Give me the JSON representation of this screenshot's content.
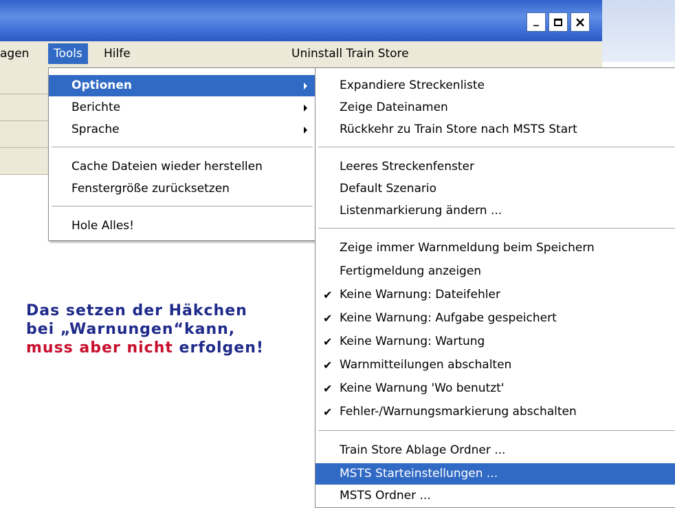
{
  "window": {
    "controls": {
      "minimize": "_",
      "maximize": "□",
      "close": "×"
    }
  },
  "menubar": {
    "items": [
      {
        "label": "agen"
      },
      {
        "label": "Tools",
        "active": true
      },
      {
        "label": "Hilfe"
      },
      {
        "label": "Uninstall Train Store"
      }
    ]
  },
  "tools_menu": {
    "items": [
      {
        "label": "Optionen",
        "submenu": true,
        "highlighted": true
      },
      {
        "label": "Berichte",
        "submenu": true
      },
      {
        "label": "Sprache",
        "submenu": true
      },
      {
        "label": "Cache Dateien wieder herstellen"
      },
      {
        "label": "Fenstergröße zurücksetzen"
      },
      {
        "label": "Hole Alles!"
      }
    ]
  },
  "options_menu": {
    "items": [
      {
        "label": "Expandiere Streckenliste",
        "checked": false
      },
      {
        "label": "Zeige Dateinamen",
        "checked": false
      },
      {
        "label": "Rückkehr zu Train Store nach MSTS Start",
        "checked": false
      },
      {
        "label": "Leeres Streckenfenster",
        "checked": false
      },
      {
        "label": "Default Szenario",
        "checked": false
      },
      {
        "label": "Listenmarkierung ändern ...",
        "checked": false
      },
      {
        "label": "Zeige immer Warnmeldung beim Speichern",
        "checked": false
      },
      {
        "label": "Fertigmeldung anzeigen",
        "checked": false
      },
      {
        "label": "Keine Warnung: Dateifehler",
        "checked": true
      },
      {
        "label": "Keine Warnung: Aufgabe gespeichert",
        "checked": true
      },
      {
        "label": "Keine Warnung: Wartung",
        "checked": true
      },
      {
        "label": "Warnmitteilungen abschalten",
        "checked": true
      },
      {
        "label": "Keine Warnung 'Wo benutzt'",
        "checked": true
      },
      {
        "label": "Fehler-/Warnungsmarkierung abschalten",
        "checked": true
      },
      {
        "label": "Train Store Ablage Ordner ...",
        "checked": false
      },
      {
        "label": "MSTS Starteinstellungen ...",
        "checked": false,
        "highlighted": true
      },
      {
        "label": "MSTS Ordner ...",
        "checked": false
      }
    ],
    "check_glyph": "✔"
  },
  "annotation": {
    "line1": "Das setzen der Häkchen",
    "line2": "bei „Warnungen“kann,",
    "line3_red": "muss aber nicht",
    "line3_blue": " erfolgen!"
  },
  "colors": {
    "highlight": "#316ac5",
    "annotation_blue": "#1f2a8a",
    "annotation_red": "#c8102e"
  }
}
